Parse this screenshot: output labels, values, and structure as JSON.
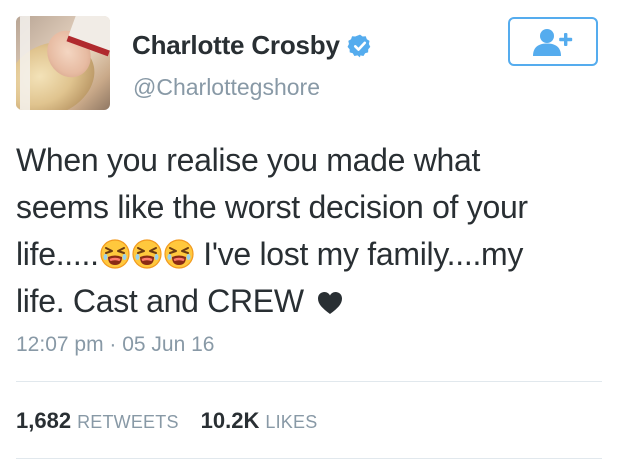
{
  "author": {
    "name": "Charlotte Crosby",
    "handle": "@Charlottegshore",
    "verified": true,
    "verified_icon": "verified-badge-icon"
  },
  "follow_button": {
    "icon": "add-user-icon",
    "color": "#55acee"
  },
  "tweet": {
    "line1": "When you realise you made what",
    "line2": "seems like the worst decision of your",
    "line3_start": "life.....",
    "emojis": [
      "tired-face-emoji",
      "tired-face-emoji",
      "tired-face-emoji"
    ],
    "line3_end": " I've lost my family....my",
    "line4": "life. Cast and CREW ",
    "trailing_icon": "black-heart-icon"
  },
  "timestamp": "12:07 pm · 05 Jun 16",
  "stats": {
    "retweets_count": "1,682",
    "retweets_label": "RETWEETS",
    "likes_count": "10.2K",
    "likes_label": "LIKES"
  },
  "colors": {
    "text": "#292f33",
    "secondary": "#8899a6",
    "accent": "#55acee",
    "divider": "#e1e8ed"
  }
}
